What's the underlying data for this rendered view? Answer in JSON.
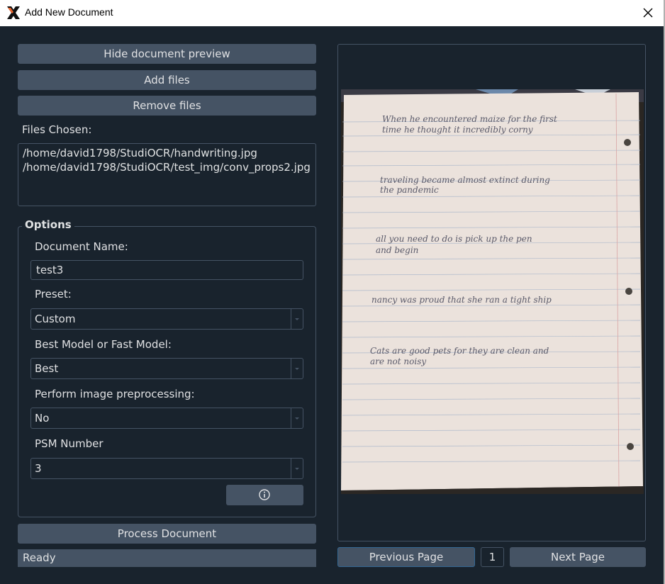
{
  "window": {
    "title": "Add New Document",
    "app_icon": "x-logo-icon",
    "close_icon": "close-icon"
  },
  "left_panel": {
    "hide_preview_label": "Hide document preview",
    "add_files_label": "Add files",
    "remove_files_label": "Remove files",
    "files_chosen_label": "Files Chosen:",
    "files": [
      "/home/david1798/StudiOCR/handwriting.jpg",
      "/home/david1798/StudiOCR/test_img/conv_props2.jpg"
    ]
  },
  "options": {
    "title": "Options",
    "document_name_label": "Document Name:",
    "document_name_value": "test3",
    "preset_label": "Preset:",
    "preset_value": "Custom",
    "model_label": "Best Model or Fast Model:",
    "model_value": "Best",
    "preprocess_label": "Perform image preprocessing:",
    "preprocess_value": "No",
    "psm_label": "PSM Number",
    "psm_value": "3",
    "info_icon": "info-icon"
  },
  "process_label": "Process Document",
  "status_text": "Ready",
  "preview": {
    "handwriting_lines": [
      "When he encountered maize for the first",
      "time he thought it incredibly corny",
      "traveling became almost extinct during",
      "the pandemic",
      "all you need to do is pick up the pen",
      "and begin",
      "nancy was proud that she ran a tight ship",
      "Cats are good pets for they are clean and",
      "are not noisy"
    ]
  },
  "pagination": {
    "prev_label": "Previous Page",
    "page_number": "1",
    "next_label": "Next Page"
  },
  "colors": {
    "background": "#19232d",
    "button": "#455364",
    "accent_border": "#346792",
    "text": "#e0e1e3"
  }
}
